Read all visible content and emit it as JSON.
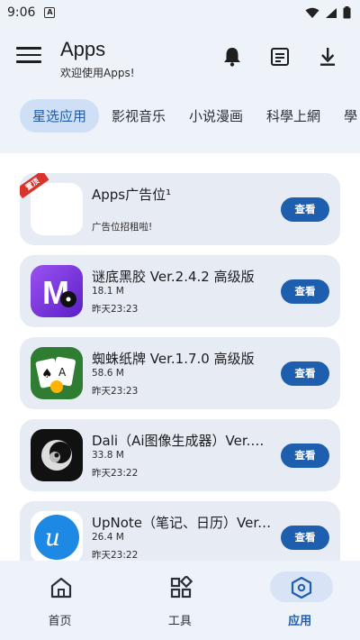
{
  "status_bar": {
    "time": "9:06",
    "badge": "A"
  },
  "header": {
    "title": "Apps",
    "subtitle": "欢迎使用Apps!",
    "icons": [
      "bell-icon",
      "notes-icon",
      "download-icon"
    ]
  },
  "tabs": [
    {
      "label": "星选应用",
      "active": true
    },
    {
      "label": "影视音乐",
      "active": false
    },
    {
      "label": "小说漫画",
      "active": false
    },
    {
      "label": "科學上網",
      "active": false
    },
    {
      "label": "學",
      "active": false
    }
  ],
  "apps": [
    {
      "name": "Apps广告位¹",
      "desc": "广告位招租啦!",
      "ribbon": "置顶",
      "button": "查看"
    },
    {
      "name": "谜底黑胶 Ver.2.4.2 高级版",
      "size": "18.1 M",
      "date": "昨天23:23",
      "button": "查看",
      "icon_color": "#7b3fe4"
    },
    {
      "name": "蜘蛛纸牌 Ver.1.7.0 高级版",
      "size": "58.6 M",
      "date": "昨天23:23",
      "button": "查看",
      "icon_color": "#2e8b3a"
    },
    {
      "name": "Dali（Ai图像生成器）Ver.1...",
      "size": "33.8 M",
      "date": "昨天23:22",
      "button": "查看",
      "icon_color": "#111111"
    },
    {
      "name": "UpNote（笔记、日历）Ver....",
      "size": "26.4 M",
      "date": "昨天23:22",
      "button": "查看",
      "icon_color": "#1e88e5"
    }
  ],
  "bottom_nav": [
    {
      "label": "首页",
      "icon": "home-icon",
      "active": false
    },
    {
      "label": "工具",
      "icon": "tools-icon",
      "active": false
    },
    {
      "label": "应用",
      "icon": "apps-icon",
      "active": true
    }
  ],
  "colors": {
    "accent": "#1d5fae",
    "header_bg": "#eef2f9",
    "card_bg": "#e7ebf3"
  }
}
